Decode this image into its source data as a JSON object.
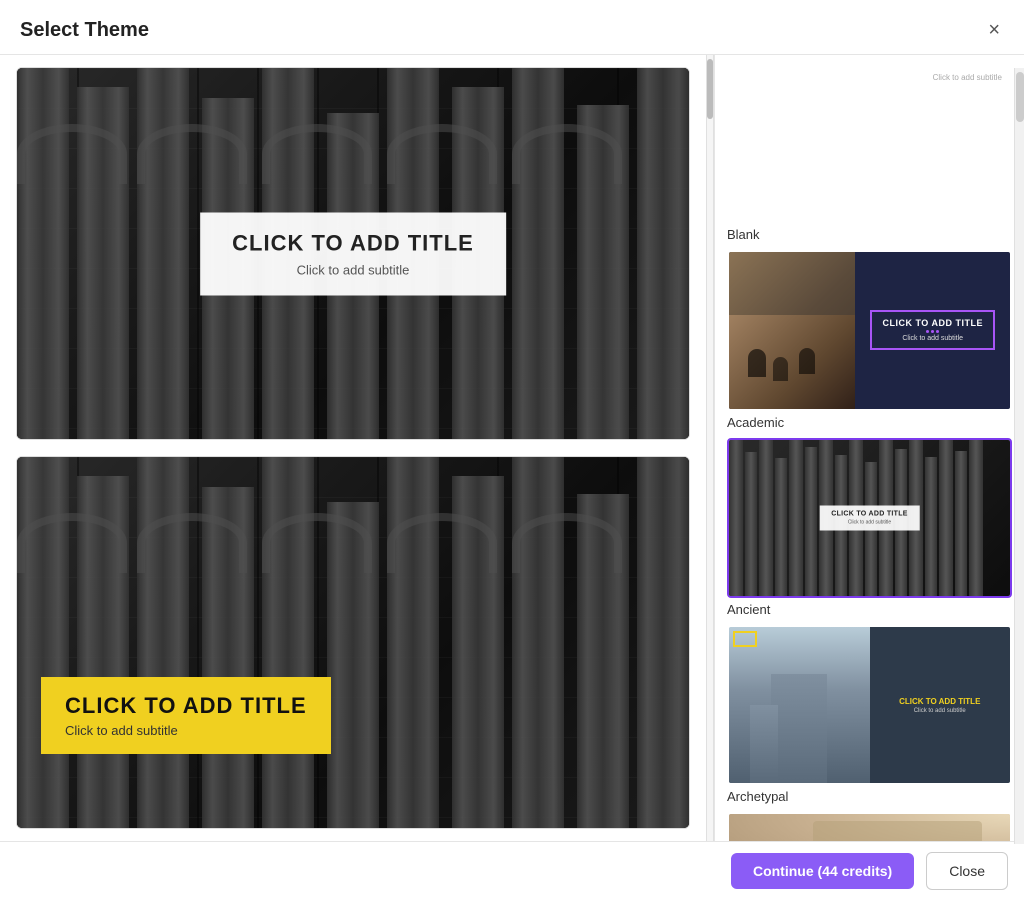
{
  "dialog": {
    "title": "Select Theme",
    "close_label": "×"
  },
  "preview": {
    "slide1": {
      "title": "CLICK TO ADD TITLE",
      "subtitle": "Click to add subtitle"
    },
    "slide2": {
      "title": "CLICK TO ADD TITLE",
      "subtitle": "Click to add subtitle"
    }
  },
  "themes": [
    {
      "name": "Blank",
      "selected": false,
      "subtitle_placeholder": "Click to add subtitle"
    },
    {
      "name": "Academic",
      "selected": false,
      "title_text": "CLICK TO ADD TITLE",
      "subtitle_text": "Click to add subtitle"
    },
    {
      "name": "Ancient",
      "selected": true,
      "title_text": "CLICK TO ADD TITLE",
      "subtitle_text": "Click to add subtitle"
    },
    {
      "name": "Archetypal",
      "selected": false,
      "title_text": "CLICK TO ADD TITLE",
      "subtitle_text": "Click to add subtitle"
    },
    {
      "name": "",
      "selected": false
    }
  ],
  "footer": {
    "continue_label": "Continue (44 credits)",
    "close_label": "Close"
  }
}
